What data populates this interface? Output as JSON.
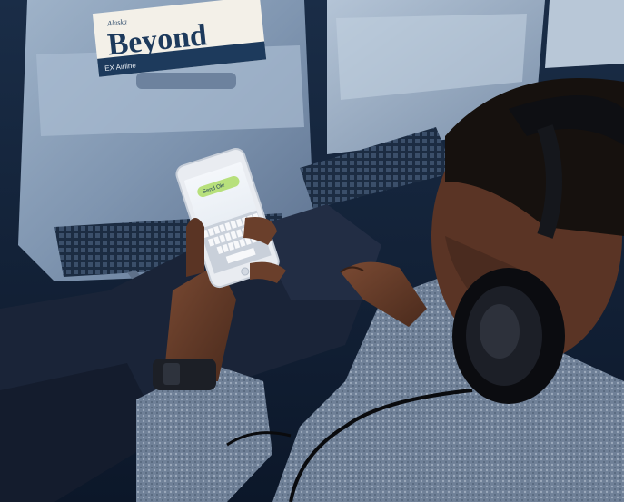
{
  "magazine": {
    "brand": "Alaska",
    "title": "Beyond",
    "bottom_line": "EX Airline"
  },
  "phone": {
    "message": "Send Ok!"
  }
}
